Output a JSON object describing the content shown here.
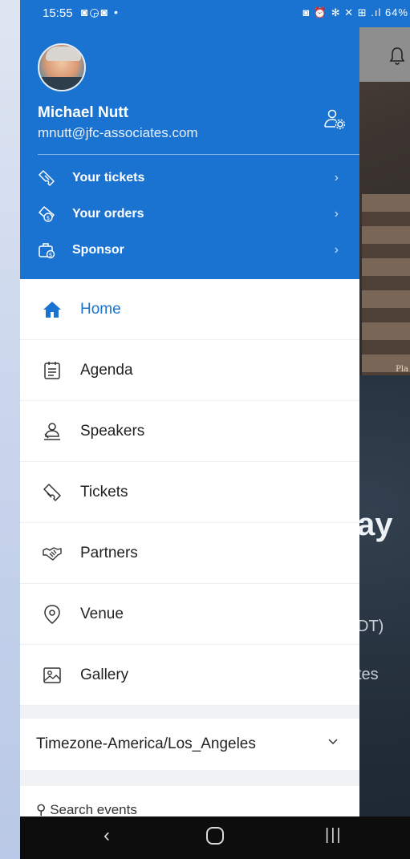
{
  "status_bar": {
    "time": "15:55",
    "left_icons": "◙◶◙ •",
    "right_icons": "◙ ⏰ ✻ ✕ ⊞ .ıl",
    "battery": "64%"
  },
  "background_app": {
    "hero_sign": "Pla",
    "headline_fragment": "ay",
    "timezone_fragment": "DT)",
    "line_fragment": "tes"
  },
  "drawer": {
    "user": {
      "name": "Michael Nutt",
      "email": "mnutt@jfc-associates.com"
    },
    "account_items": [
      {
        "label": "Your tickets",
        "icon": "ticket-icon"
      },
      {
        "label": "Your orders",
        "icon": "orders-icon"
      },
      {
        "label": "Sponsor",
        "icon": "sponsor-icon"
      }
    ],
    "nav_items": [
      {
        "label": "Home",
        "icon": "home-icon",
        "active": true
      },
      {
        "label": "Agenda",
        "icon": "agenda-icon"
      },
      {
        "label": "Speakers",
        "icon": "speakers-icon"
      },
      {
        "label": "Tickets",
        "icon": "tickets-icon"
      },
      {
        "label": "Partners",
        "icon": "handshake-icon"
      },
      {
        "label": "Venue",
        "icon": "location-icon"
      },
      {
        "label": "Gallery",
        "icon": "gallery-icon"
      }
    ],
    "timezone": "Timezone-America/Los_Angeles",
    "search_placeholder": "Search events"
  },
  "colors": {
    "accent": "#1a73d1",
    "drawer_bg": "#f1f2f4",
    "nav_bar": "#0d0d0d"
  }
}
